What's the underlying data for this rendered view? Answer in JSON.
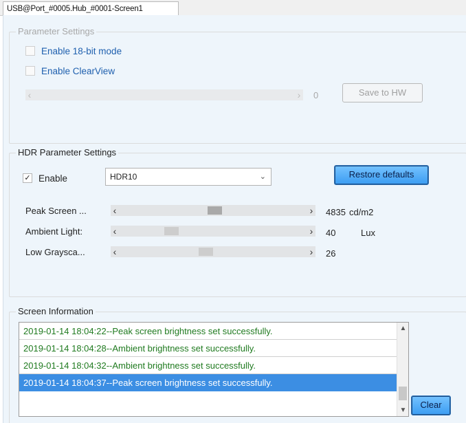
{
  "tab": {
    "label": "USB@Port_#0005.Hub_#0001-Screen1"
  },
  "parameter_settings": {
    "title": "Parameter Settings",
    "enable_18bit_label": "Enable 18-bit mode",
    "enable_18bit_checked": false,
    "enable_clearview_label": "Enable ClearView",
    "enable_clearview_checked": false,
    "slider_value": "0",
    "save_button_label": "Save to HW"
  },
  "hdr": {
    "title": "HDR Parameter Settings",
    "enable_label": "Enable",
    "enable_check_glyph": "✓",
    "enable_checked": true,
    "mode_selected": "HDR10",
    "restore_button_label": "Restore defaults",
    "sliders": [
      {
        "label": "Peak Screen ...",
        "value": "4835",
        "unit": "cd/m2",
        "position_fraction": 0.51
      },
      {
        "label": "Ambient Light:",
        "value": "40",
        "unit": "Lux",
        "position_fraction": 0.26
      },
      {
        "label": "Low Graysca...",
        "value": "26",
        "unit": "",
        "position_fraction": 0.46
      }
    ]
  },
  "screen_info": {
    "title": "Screen Information",
    "log": [
      "2019-01-14 18:04:22--Peak screen brightness set successfully.",
      "2019-01-14 18:04:28--Ambient brightness set successfully.",
      "2019-01-14 18:04:32--Ambient brightness set successfully.",
      "2019-01-14 18:04:37--Peak screen brightness set successfully."
    ],
    "selected_index": 3,
    "clear_button_label": "Clear"
  },
  "colors": {
    "panel_bg": "#eef5fb",
    "accent_blue": "#3c8ee3",
    "log_green": "#1f7a1f",
    "link_blue": "#1e5fae"
  },
  "icons": {
    "slider_left": "chevron-left-icon",
    "slider_right": "chevron-right-icon",
    "dropdown": "chevron-down-icon",
    "scroll_up": "chevron-up-icon",
    "scroll_down": "chevron-down-icon"
  }
}
